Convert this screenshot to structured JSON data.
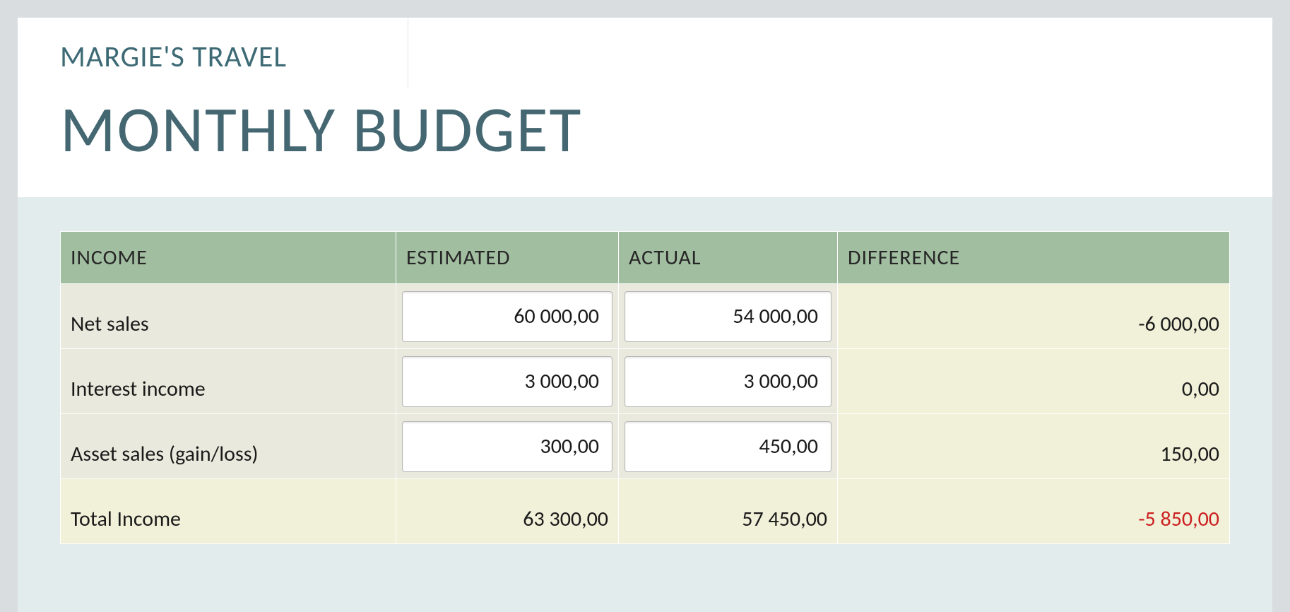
{
  "header": {
    "company": "MARGIE'S TRAVEL",
    "title": "MONTHLY BUDGET"
  },
  "table": {
    "columns": {
      "income": "INCOME",
      "estimated": "ESTIMATED",
      "actual": "ACTUAL",
      "difference": "DIFFERENCE"
    },
    "rows": [
      {
        "label": "Net sales",
        "estimated": "60 000,00",
        "actual": "54 000,00",
        "difference": "-6 000,00",
        "diff_negative": false
      },
      {
        "label": "Interest income",
        "estimated": "3 000,00",
        "actual": "3 000,00",
        "difference": "0,00",
        "diff_negative": false
      },
      {
        "label": "Asset sales (gain/loss)",
        "estimated": "300,00",
        "actual": "450,00",
        "difference": "150,00",
        "diff_negative": false
      }
    ],
    "total": {
      "label": "Total Income",
      "estimated": "63 300,00",
      "actual": "57 450,00",
      "difference": "-5 850,00",
      "diff_negative": true
    }
  }
}
